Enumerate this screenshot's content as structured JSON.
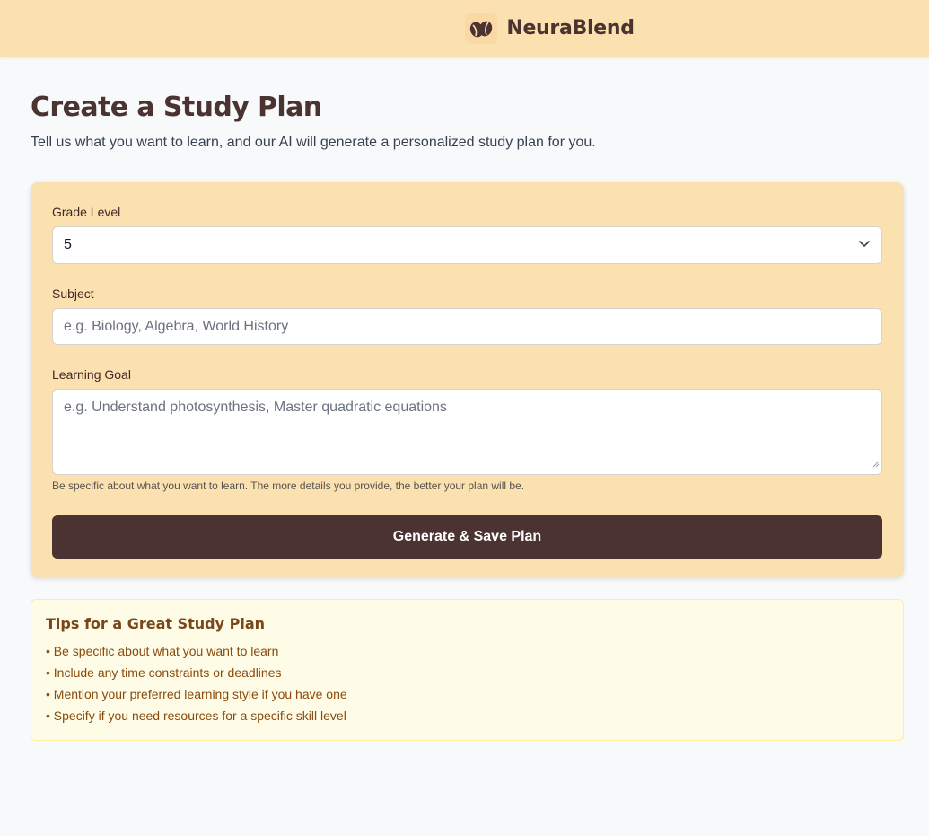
{
  "header": {
    "brand_name": "NeuraBlend",
    "logo_icon": "coffee-bean-icon"
  },
  "page": {
    "title": "Create a Study Plan",
    "subtitle": "Tell us what you want to learn, and our AI will generate a personalized study plan for you."
  },
  "form": {
    "grade_label": "Grade Level",
    "grade_value": "5",
    "subject_label": "Subject",
    "subject_placeholder": "e.g. Biology, Algebra, World History",
    "goal_label": "Learning Goal",
    "goal_placeholder": "e.g. Understand photosynthesis, Master quadratic equations",
    "goal_help": "Be specific about what you want to learn. The more details you provide, the better your plan will be.",
    "submit_label": "Generate & Save Plan"
  },
  "tips": {
    "title": "Tips for a Great Study Plan",
    "items": [
      "• Be specific about what you want to learn",
      "• Include any time constraints or deadlines",
      "• Mention your preferred learning style if you have one",
      "• Specify if you need resources for a specific skill level"
    ]
  },
  "colors": {
    "header_bg": "#fbe0b0",
    "brand_text": "#4a3330",
    "button_bg": "#4a3330",
    "tips_bg": "#fefbe6",
    "tips_text": "#8a4b0e"
  }
}
